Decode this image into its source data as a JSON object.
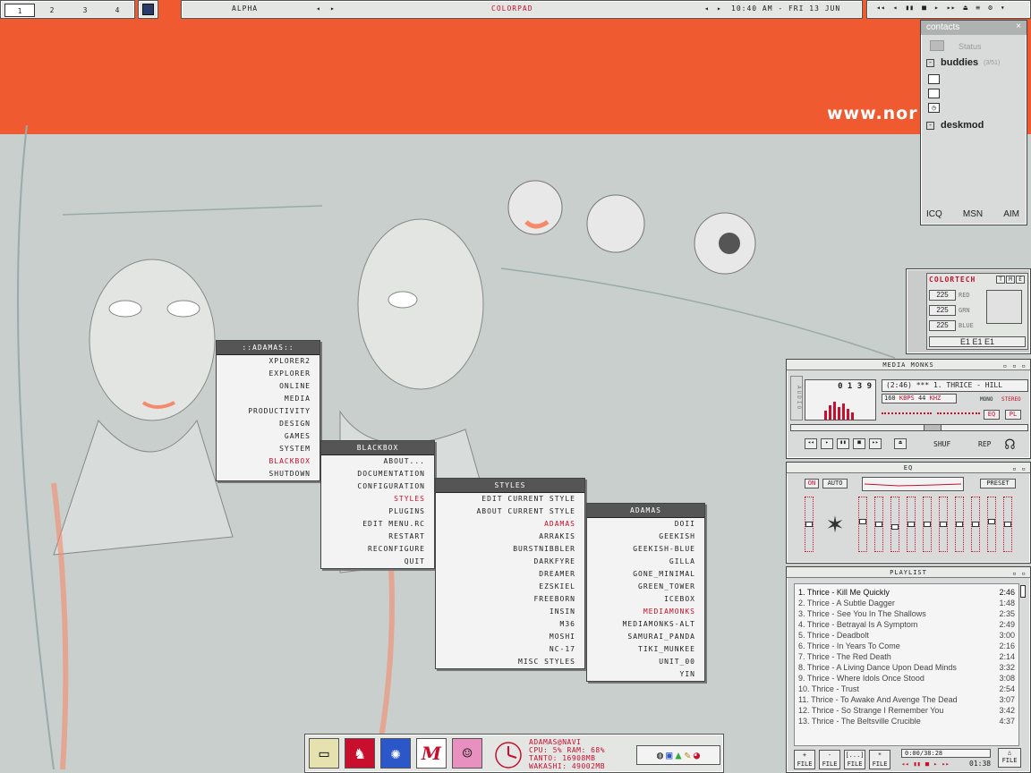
{
  "workspaces": {
    "items": [
      {
        "label": "1"
      },
      {
        "label": "2"
      },
      {
        "label": "3"
      },
      {
        "label": "4"
      }
    ]
  },
  "topbar": {
    "workspace_name": "ALPHA",
    "window_title": "COLORPAD",
    "clock": "10:40 AM - FRI 13 JUN"
  },
  "wallpaper": {
    "url_text": "www.nor"
  },
  "contacts": {
    "title": "contacts",
    "status_label": "Status",
    "group1": "buddies",
    "group1_count": "(3/51)",
    "group2": "deskmod",
    "tabs": [
      "ICQ",
      "MSN",
      "AIM"
    ]
  },
  "colortech": {
    "title": "COLORTECH",
    "tme": [
      "T",
      "M",
      "E"
    ],
    "red_value": "225",
    "red_label": "RED",
    "grn_value": "225",
    "grn_label": "GRN",
    "blue_value": "225",
    "blue_label": "BLUE",
    "hex": "E1 E1 E1",
    "swatch": "#e1e1e1"
  },
  "menus": {
    "root": {
      "title": "::ADAMAS::",
      "items": [
        "XPLORER2",
        "EXPLORER",
        "ONLINE",
        "MEDIA",
        "PRODUCTIVITY",
        "DESIGN",
        "GAMES",
        "SYSTEM",
        "BLACKBOX",
        "SHUTDOWN"
      ]
    },
    "blackbox": {
      "title": "BLACKBOX",
      "items": [
        "ABOUT...",
        "DOCUMENTATION",
        "CONFIGURATION",
        "STYLES",
        "PLUGINS",
        "EDIT MENU.RC",
        "RESTART",
        "RECONFIGURE",
        "QUIT"
      ]
    },
    "styles": {
      "title": "STYLES",
      "items": [
        "EDIT CURRENT STYLE",
        "ABOUT CURRENT STYLE",
        "ADAMAS",
        "ARRAKIS",
        "BURSTNIBBLER",
        "DARKFYRE",
        "DREAMER",
        "EZSKIEL",
        "FREEBORN",
        "INSIN",
        "M36",
        "MOSHI",
        "NC-17",
        "MISC STYLES"
      ]
    },
    "adamas": {
      "title": "ADAMAS",
      "items": [
        "DOII",
        "GEEKISH",
        "GEEKISH-BLUE",
        "GILLA",
        "GONE_MINIMAL",
        "GREEN_TOWER",
        "ICEBOX",
        "MEDIAMONKS",
        "MEDIAMONKS-ALT",
        "SAMURAI_PANDA",
        "TIKI_MUNKEE",
        "UNIT_00",
        "YIN"
      ]
    }
  },
  "player": {
    "title": "MEDIA MONKS",
    "side_label": "AUDIO",
    "time": "0 1 3 9",
    "song": "(2:46) *** 1. THRICE - HILL",
    "bitrate": "160",
    "kbps_label": "KBPS",
    "khz": "44",
    "khz_label": "KHZ",
    "mono": "MONO",
    "stereo": "STEREO",
    "eq_btn": "EQ",
    "pl_btn": "PL",
    "shuf": "SHUF",
    "rep": "REP"
  },
  "eq": {
    "title": "EQ",
    "on": "ON",
    "auto": "AUTO",
    "preset": "PRESET",
    "preamp_level": 0.5,
    "bands": [
      0.55,
      0.5,
      0.45,
      0.5,
      0.5,
      0.5,
      0.5,
      0.5,
      0.55,
      0.5
    ]
  },
  "playlist": {
    "title": "PLAYLIST",
    "items": [
      {
        "title": "1. Thrice - Kill Me Quickly",
        "time": "2:46"
      },
      {
        "title": "2. Thrice - A Subtle Dagger",
        "time": "1:48"
      },
      {
        "title": "3. Thrice - See You In The Shallows",
        "time": "2:35"
      },
      {
        "title": "4. Thrice - Betrayal Is A Symptom",
        "time": "2:49"
      },
      {
        "title": "5. Thrice - Deadbolt",
        "time": "3:00"
      },
      {
        "title": "6. Thrice - In Years To Come",
        "time": "2:16"
      },
      {
        "title": "7. Thrice - The Red Death",
        "time": "2:14"
      },
      {
        "title": "8. Thrice - A Living Dance Upon Dead Minds",
        "time": "3:32"
      },
      {
        "title": "9. Thrice - Where Idols Once Stood",
        "time": "3:08"
      },
      {
        "title": "10. Thrice - Trust",
        "time": "2:54"
      },
      {
        "title": "11. Thrice - To Awake And Avenge The Dead",
        "time": "3:07"
      },
      {
        "title": "12. Thrice - So Strange I Remember You",
        "time": "3:42"
      },
      {
        "title": "13. Thrice - The Beltsville Crucible",
        "time": "4:37"
      }
    ],
    "buttons": [
      {
        "sym": "+",
        "label": "FILE"
      },
      {
        "sym": "-",
        "label": "FILE"
      },
      {
        "sym": "[...]",
        "label": "FILE"
      },
      {
        "sym": "*",
        "label": "FILE"
      }
    ],
    "total": "0:00/38:28",
    "elapsed": "01:38",
    "last_btn": "FILE"
  },
  "sysinfo": {
    "line1": "ADAMAS@NAVI",
    "line2": "CPU: 5% RAM: 68%",
    "line3": "TANTO: 16908MB",
    "line4": "WAKASHI: 49002MB"
  },
  "colors": {
    "accent": "#c8102e",
    "wallpaper_band": "#f05a30"
  }
}
